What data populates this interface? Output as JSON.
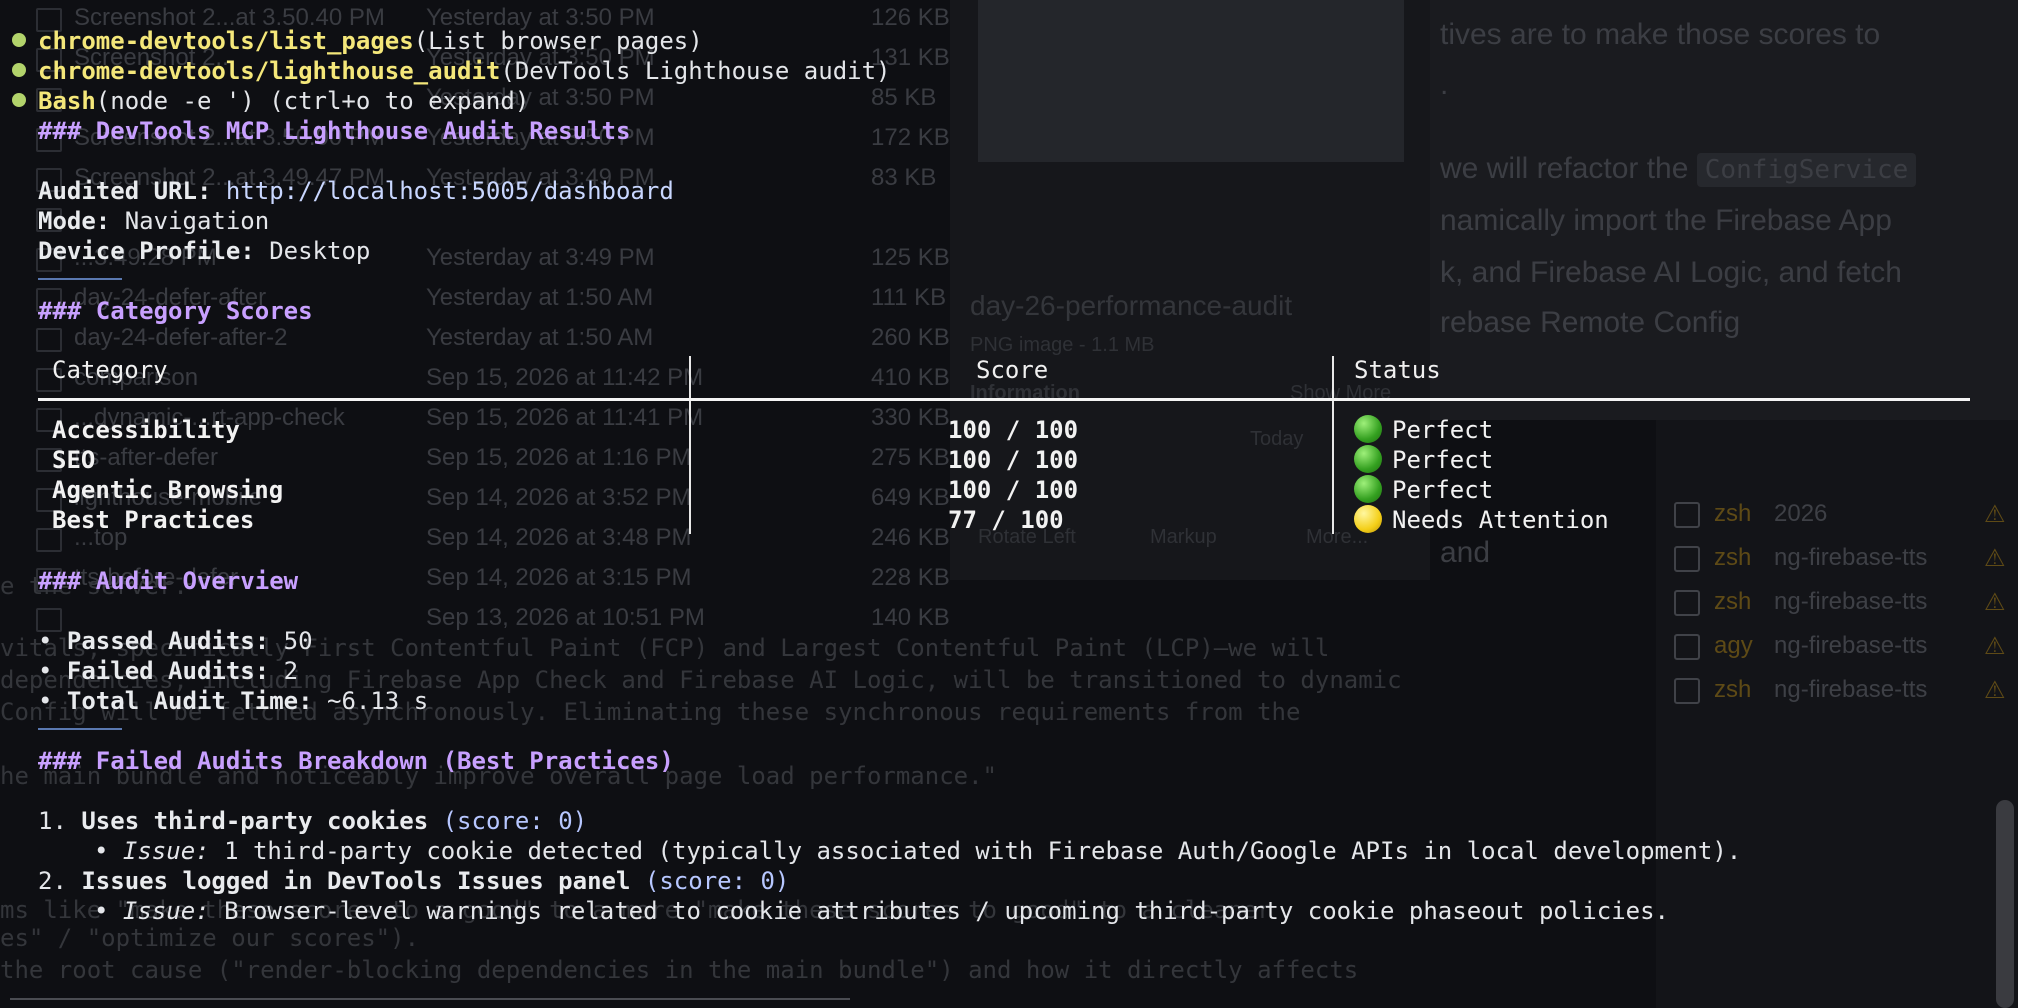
{
  "background": {
    "finder_rows": [
      {
        "name": "Screenshot 2...at 3.50.40 PM",
        "date": "Yesterday at 3:50 PM",
        "size": "126 KB"
      },
      {
        "name": "Screenshot 2...",
        "date": "Yesterday at 3:50 PM",
        "size": "131 KB"
      },
      {
        "name": "",
        "date": "Yesterday at 3:50 PM",
        "size": "85 KB"
      },
      {
        "name": "Screenshot 2...at 3.50.00 PM",
        "date": "Yesterday at 3:50 PM",
        "size": "172 KB"
      },
      {
        "name": "Screenshot 2...at 3.49.47 PM",
        "date": "Yesterday at 3:49 PM",
        "size": "83 KB"
      },
      {
        "name": "",
        "date": "",
        "size": ""
      },
      {
        "name": "...3.49.28 PM",
        "date": "Yesterday at 3:49 PM",
        "size": "125 KB"
      },
      {
        "name": "day-24-defer-after",
        "date": "Yesterday at 1:50 AM",
        "size": "111 KB"
      },
      {
        "name": "day-24-defer-after-2",
        "date": "Yesterday at 1:50 AM",
        "size": "260 KB"
      },
      {
        "name": "comparison",
        "date": "Sep 15, 2026 at 11:42 PM",
        "size": "410 KB"
      },
      {
        "name": "...dynamic-...rt-app-check",
        "date": "Sep 15, 2026 at 11:41 PM",
        "size": "330 KB"
      },
      {
        "name": "tts-after-defer",
        "date": "Sep 15, 2026 at 1:16 PM",
        "size": "275 KB"
      },
      {
        "name": "lighthouse-mobile",
        "date": "Sep 14, 2026 at 3:52 PM",
        "size": "649 KB"
      },
      {
        "name": "...top",
        "date": "Sep 14, 2026 at 3:48 PM",
        "size": "246 KB"
      },
      {
        "name": "tts-before-defer",
        "date": "Sep 14, 2026 at 3:15 PM",
        "size": "228 KB"
      },
      {
        "name": "",
        "date": "Sep 13, 2026 at 10:51 PM",
        "size": "140 KB"
      }
    ],
    "preview": {
      "title": "day-26-performance-audit",
      "subtitle": "PNG image - 1.1 MB",
      "info": "Information",
      "show_more": "Show More",
      "today": "Today",
      "rotate": "Rotate Left",
      "markup": "Markup",
      "more": "More..."
    },
    "doc_lines": [
      "tives are to make those scores to",
      ".",
      "we will refactor the",
      "namically import the Firebase App",
      "k, and Firebase AI Logic, and fetch",
      "rebase Remote Config",
      "and"
    ],
    "doc_code": "ConfigService",
    "bg_mono": [
      "e the server.",
      "vitals, specifically First Contentful Paint (FCP) and Largest Contentful Paint (LCP)—we will",
      " dependencies, including Firebase App Check and Firebase AI Logic, will be transitioned to dynamic",
      "Config will be fetched asynchronously. Eliminating these synchronous requirements from the",
      "he main bundle and noticeably improve overall page load performance.\"",
      "ms like \"make these scores to a good\" to a more \"make these scores to good\" to a cleaner",
      "es\" / \"optimize our scores\").",
      " the root cause (\"render-blocking dependencies in the main bundle\") and how it directly affects"
    ],
    "terminal_list": [
      {
        "shell": "zsh",
        "dir": "2026"
      },
      {
        "shell": "zsh",
        "dir": "ng-firebase-tts"
      },
      {
        "shell": "zsh",
        "dir": "ng-firebase-tts"
      },
      {
        "shell": "agy",
        "dir": "ng-firebase-tts"
      },
      {
        "shell": "zsh",
        "dir": "ng-firebase-tts"
      }
    ]
  },
  "calls": [
    {
      "tool": "chrome-devtools/list_pages",
      "args": "(List browser pages)"
    },
    {
      "tool": "chrome-devtools/lighthouse_audit",
      "args": "(DevTools Lighthouse audit)"
    },
    {
      "tool": "Bash",
      "args": "(node -e ') (ctrl+o to expand)"
    }
  ],
  "results": {
    "heading": "### DevTools MCP Lighthouse Audit Results",
    "audited_url_label": "Audited URL:",
    "audited_url": "http://localhost:5005/dashboard",
    "mode_label": "Mode:",
    "mode": "Navigation",
    "device_label": "Device Profile:",
    "device": "Desktop"
  },
  "category": {
    "heading": "### Category Scores",
    "headers": {
      "category": "Category",
      "score": "Score",
      "status": "Status"
    },
    "rows": [
      {
        "category": "Accessibility",
        "score": "100 / 100",
        "status": "Perfect",
        "color": "green"
      },
      {
        "category": "SEO",
        "score": "100 / 100",
        "status": "Perfect",
        "color": "green"
      },
      {
        "category": "Agentic Browsing",
        "score": "100 / 100",
        "status": "Perfect",
        "color": "green"
      },
      {
        "category": "Best Practices",
        "score": "77 / 100",
        "status": "Needs Attention",
        "color": "yellow"
      }
    ]
  },
  "overview": {
    "heading": "### Audit Overview",
    "items": [
      {
        "label": "Passed Audits:",
        "value": "50"
      },
      {
        "label": "Failed Audits:",
        "value": "2"
      },
      {
        "label": "Total Audit Time:",
        "value": "~6.13 s"
      }
    ]
  },
  "failed": {
    "heading": "### Failed Audits Breakdown (Best Practices)",
    "items": [
      {
        "num": "1.",
        "title": "Uses third-party cookies",
        "score": "(score: 0)",
        "issue_label": "Issue:",
        "issue": "1 third-party cookie detected (typically associated with Firebase Auth/Google APIs in local development)."
      },
      {
        "num": "2.",
        "title": "Issues logged in DevTools Issues panel",
        "score": "(score: 0)",
        "issue_label": "Issue:",
        "issue": "Browser-level warnings related to cookie attributes / upcoming third-party cookie phaseout policies."
      }
    ]
  },
  "colors": {
    "tool": "#f4e77a",
    "heading": "#c8a0ff",
    "url": "#c9d7ff",
    "dot": "#b2d36b",
    "status_green": "#34a020",
    "status_yellow": "#f4cf18"
  }
}
